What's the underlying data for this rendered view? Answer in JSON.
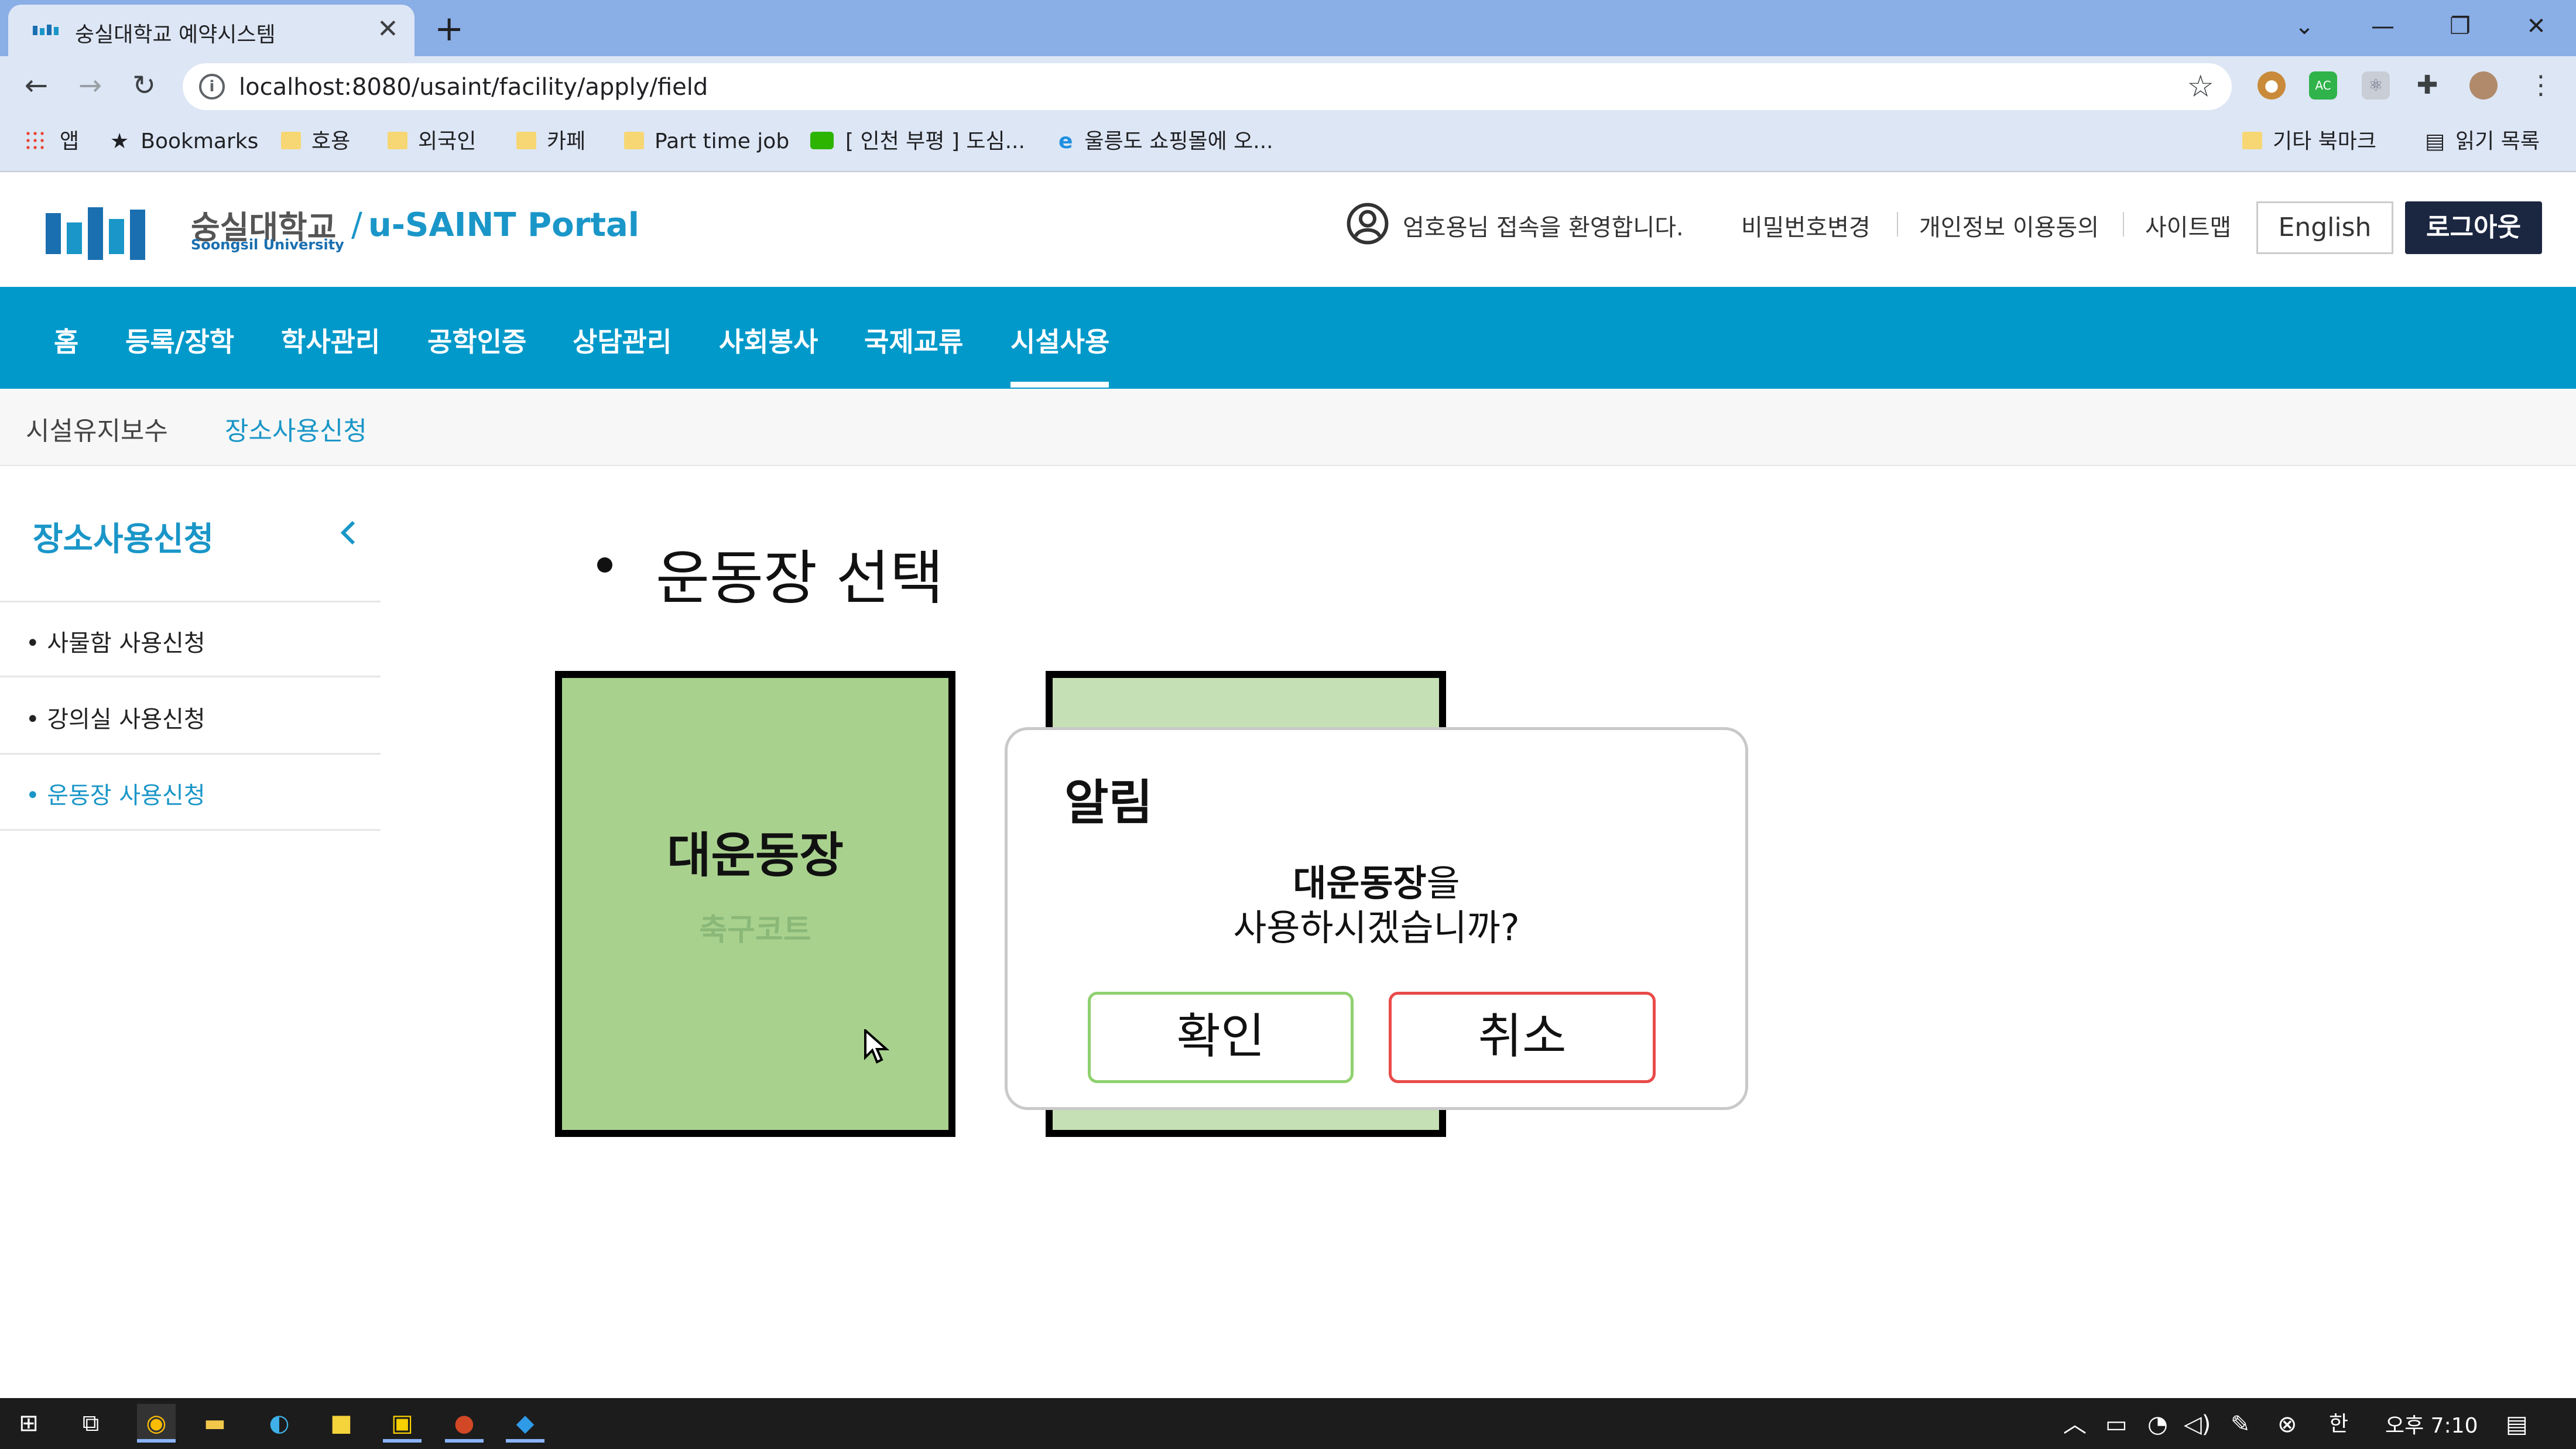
{
  "browser": {
    "tab_title": "숭실대학교 예약시스템",
    "url": "localhost:8080/usaint/facility/apply/field",
    "bookmarks": [
      {
        "label": "앱"
      },
      {
        "label": "Bookmarks"
      },
      {
        "label": "호용"
      },
      {
        "label": "외국인"
      },
      {
        "label": "카페"
      },
      {
        "label": "Part time job"
      },
      {
        "label": "[ 인천 부평 ] 도심..."
      },
      {
        "label": "울릉도 쇼핑몰에 오..."
      },
      {
        "label": "기타 북마크"
      },
      {
        "label": "읽기 목록"
      }
    ]
  },
  "header": {
    "university": "숭실대학교",
    "university_en": "Soongsil University",
    "portal_title": "u-SAINT Portal",
    "welcome": "엄호용님 접속을 환영합니다.",
    "links": [
      "비밀번호변경",
      "개인정보 이용동의",
      "사이트맵"
    ],
    "english_label": "English",
    "logout_label": "로그아웃"
  },
  "main_nav": {
    "items": [
      "홈",
      "등록/장학",
      "학사관리",
      "공학인증",
      "상담관리",
      "사회봉사",
      "국제교류",
      "시설사용"
    ],
    "active": "시설사용"
  },
  "sub_nav": {
    "items": [
      "시설유지보수",
      "장소사용신청"
    ],
    "active": "장소사용신청"
  },
  "sidebar": {
    "title": "장소사용신청",
    "items": [
      "사물함 사용신청",
      "강의실 사용신청",
      "운동장 사용신청"
    ],
    "active": "운동장 사용신청"
  },
  "content": {
    "title": "운동장 선택",
    "cards": [
      {
        "name": "대운동장",
        "sub": "축구코트",
        "color": "#a9d18e"
      },
      {
        "name": "",
        "sub": "",
        "color": "#c5e0b4"
      }
    ]
  },
  "dialog": {
    "title": "알림",
    "message_bold": "대운동장",
    "message_suffix": "을",
    "message_line2": "사용하시겠습니까?",
    "ok_label": "확인",
    "cancel_label": "취소"
  },
  "taskbar": {
    "time": "오후 7:10",
    "ime": "한"
  },
  "colors": {
    "accent_blue": "#0199ca",
    "dark_navy": "#1b2640",
    "ok_green": "#8fd16f",
    "cancel_red": "#e94a4a"
  }
}
